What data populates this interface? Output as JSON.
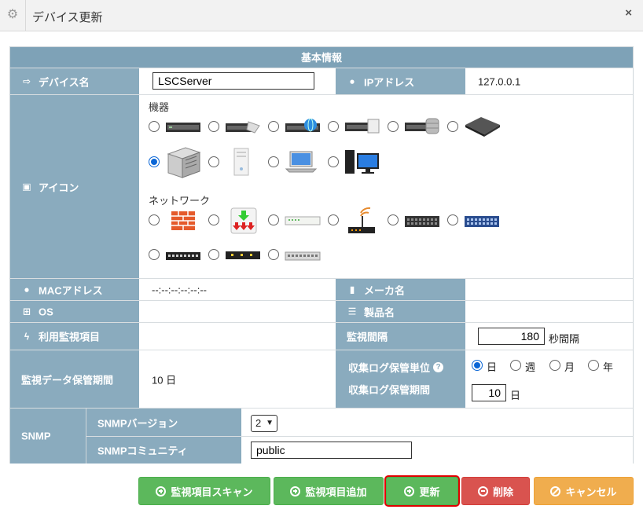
{
  "window": {
    "title": "デバイス更新",
    "close_label": "×"
  },
  "section_header": "基本情報",
  "device_name": {
    "label": "デバイス名",
    "value": "LSCServer"
  },
  "ip": {
    "label": "IPアドレス",
    "value": "127.0.0.1"
  },
  "icon": {
    "label": "アイコン",
    "equipment_title": "機器",
    "network_title": "ネットワーク",
    "selected": "server-tower-icon",
    "equipment_icons": [
      "rack-server-icon",
      "rack-server-cable-icon",
      "rack-server-globe-icon",
      "rack-server-doc-icon",
      "rack-server-db-icon",
      "storage-unit-icon",
      "server-tower-icon",
      "pc-tower-icon",
      "laptop-icon",
      "desktop-pc-icon"
    ],
    "network_icons": [
      "firewall-icon",
      "router-download-icon",
      "switch-light-icon",
      "wifi-router-icon",
      "switch-dark-icon",
      "switch-blue-icon",
      "switch-black-24-icon",
      "switch-black-8-icon",
      "switch-gray-icon"
    ]
  },
  "mac": {
    "label": "MACアドレス",
    "value": "--:--:--:--:--:--"
  },
  "maker": {
    "label": "メーカ名",
    "value": ""
  },
  "os": {
    "label": "OS",
    "value": ""
  },
  "product": {
    "label": "製品名",
    "value": ""
  },
  "monitor_items": {
    "label": "利用監視項目",
    "value": ""
  },
  "interval": {
    "label": "監視間隔",
    "value": "180",
    "unit": "秒間隔"
  },
  "retention": {
    "label": "監視データ保管期間",
    "value": "10 日"
  },
  "log_unit": {
    "label": "収集ログ保管単位",
    "help": "?",
    "options": [
      "日",
      "週",
      "月",
      "年"
    ],
    "selected": "日"
  },
  "log_period": {
    "label": "収集ログ保管期間",
    "value": "10",
    "unit": "日"
  },
  "snmp": {
    "label": "SNMP",
    "version_label": "SNMPバージョン",
    "version_value": "2",
    "community_label": "SNMPコミュニティ",
    "community_value": "public"
  },
  "buttons": {
    "scan": "監視項目スキャン",
    "add": "監視項目追加",
    "update": "更新",
    "delete": "削除",
    "cancel": "キャンセル"
  },
  "colors": {
    "header": "#7ea2b7",
    "label_bg": "#8aabbe",
    "green": "#5cb85c",
    "red": "#d9534f",
    "orange": "#f0ad4e",
    "highlight": "#e00000"
  }
}
